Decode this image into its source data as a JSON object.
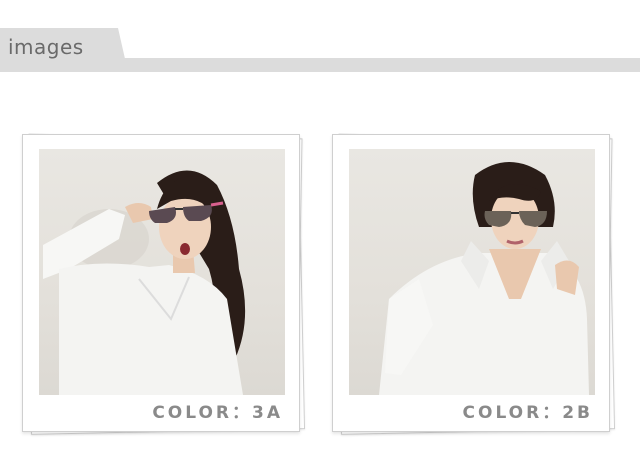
{
  "header": {
    "title": "images"
  },
  "photos": [
    {
      "caption": "COLOR：3A"
    },
    {
      "caption": "COLOR：2B"
    }
  ],
  "colors": {
    "header_bg": "#dcdcdc",
    "header_text": "#6a6a6a",
    "caption_text": "#8a8a8a",
    "lens_3a": "#5a4a52",
    "frame_3a_tip": "#d9608e",
    "lens_2b": "#6b6258"
  }
}
